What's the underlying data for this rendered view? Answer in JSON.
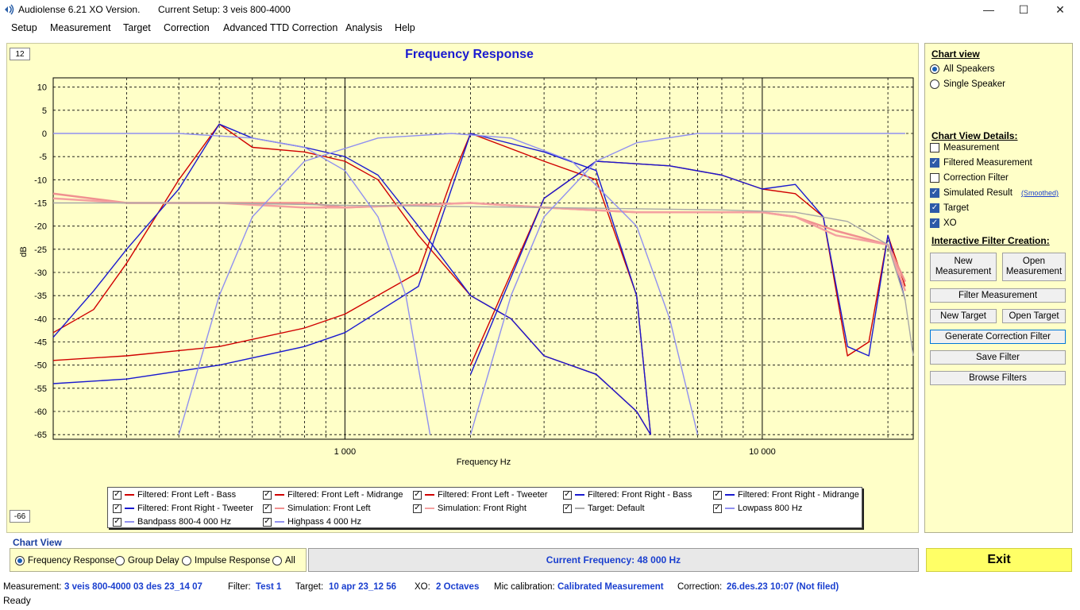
{
  "window": {
    "app_title": "Audiolense 6.21 XO Version.",
    "setup": "Current Setup: 3 veis 800-4000",
    "minimize": "—",
    "maximize": "☐",
    "close": "✕"
  },
  "menu": [
    "Setup",
    "Measurement",
    "Target",
    "Correction",
    "Advanced TTD Correction",
    "Analysis",
    "Help"
  ],
  "chart": {
    "top_box": "12",
    "bottom_box": "-66",
    "y_ticks": [
      "10",
      "5",
      "0",
      "-5",
      "-10",
      "-15",
      "-20",
      "-25",
      "-30",
      "-35",
      "-40",
      "-45",
      "-50",
      "-55",
      "-60",
      "-65"
    ],
    "x_ticks": [
      "1 000",
      "10 000"
    ]
  },
  "chart_data": {
    "type": "line",
    "title": "Frequency Response",
    "xlabel": "Frequency Hz",
    "ylabel": "dB",
    "x_scale": "log",
    "xlim": [
      200,
      23000
    ],
    "ylim": [
      -66,
      12
    ],
    "grid": true,
    "legend_placement": "bottom",
    "series": [
      {
        "name": "Filtered: Front Left - Bass",
        "color": "#d00000",
        "x": [
          200,
          250,
          300,
          400,
          500,
          600,
          800,
          1000,
          1200,
          1500,
          2000,
          2500,
          3000,
          4000,
          5000,
          5400
        ],
        "y": [
          -43,
          -38,
          -28,
          -10,
          2,
          -3,
          -4,
          -6,
          -10,
          -22,
          -35,
          -40,
          -48,
          -52,
          -60,
          -65
        ]
      },
      {
        "name": "Filtered: Front Left - Midrange",
        "color": "#d00000",
        "x": [
          200,
          300,
          500,
          800,
          1000,
          1500,
          1800,
          2000,
          3000,
          4000,
          5000,
          5400
        ],
        "y": [
          -49,
          -48,
          -46,
          -42,
          -39,
          -30,
          -10,
          0,
          -6,
          -10,
          -35,
          -65
        ]
      },
      {
        "name": "Filtered: Front Left - Tweeter",
        "color": "#d00000",
        "x": [
          2000,
          3000,
          4000,
          6000,
          8000,
          10000,
          12000,
          14000,
          16000,
          18000,
          20000,
          22000
        ],
        "y": [
          -50,
          -14,
          -6,
          -7,
          -9,
          -12,
          -13,
          -18,
          -48,
          -45,
          -22,
          -33
        ]
      },
      {
        "name": "Filtered: Front Right - Bass",
        "color": "#1a1ad0",
        "x": [
          200,
          250,
          300,
          400,
          500,
          600,
          800,
          1000,
          1200,
          1500,
          2000,
          2500,
          3000,
          4000,
          5000,
          5400
        ],
        "y": [
          -44,
          -34,
          -25,
          -12,
          2,
          -1,
          -3,
          -5,
          -9,
          -20,
          -35,
          -40,
          -48,
          -52,
          -60,
          -65
        ]
      },
      {
        "name": "Filtered: Front Right - Midrange",
        "color": "#1a1ad0",
        "x": [
          200,
          300,
          500,
          800,
          1000,
          1500,
          1800,
          2000,
          3000,
          4000,
          5000,
          5400
        ],
        "y": [
          -54,
          -53,
          -50,
          -46,
          -43,
          -33,
          -12,
          0,
          -4,
          -8,
          -35,
          -65
        ]
      },
      {
        "name": "Filtered: Front Right - Tweeter",
        "color": "#1a1ad0",
        "x": [
          2000,
          3000,
          4000,
          6000,
          8000,
          10000,
          12000,
          14000,
          16000,
          18000,
          20000,
          22000
        ],
        "y": [
          -52,
          -14,
          -6,
          -7,
          -9,
          -12,
          -11,
          -18,
          -46,
          -48,
          -22,
          -36
        ]
      },
      {
        "name": "Simulation: Front Left",
        "color": "#f09090",
        "x": [
          200,
          300,
          500,
          800,
          1000,
          2000,
          3000,
          5000,
          8000,
          10000,
          12000,
          15000,
          20000,
          22000
        ],
        "y": [
          -13,
          -15,
          -15,
          -15,
          -16,
          -15,
          -16,
          -17,
          -17,
          -17,
          -18,
          -21,
          -24,
          -32
        ]
      },
      {
        "name": "Simulation: Front Right",
        "color": "#f4a0a0",
        "x": [
          200,
          300,
          500,
          800,
          1000,
          2000,
          3000,
          5000,
          8000,
          10000,
          12000,
          15000,
          20000,
          22000
        ],
        "y": [
          -14,
          -15,
          -15,
          -16,
          -16,
          -15,
          -16,
          -17,
          -17,
          -17,
          -18,
          -22,
          -24,
          -34
        ]
      },
      {
        "name": "Target: Default",
        "color": "#a8a8a8",
        "x": [
          200,
          500,
          1000,
          3000,
          8000,
          12000,
          16000,
          20000,
          22000,
          23000
        ],
        "y": [
          -15,
          -15,
          -15.5,
          -16,
          -16.5,
          -17,
          -19,
          -24,
          -36,
          -48
        ]
      },
      {
        "name": "Lowpass 800 Hz",
        "color": "#9090f0",
        "x": [
          200,
          400,
          600,
          800,
          1000,
          1200,
          1400,
          1600
        ],
        "y": [
          0,
          0,
          -1,
          -3,
          -8,
          -18,
          -35,
          -65
        ]
      },
      {
        "name": "Bandpass 800-4 000 Hz",
        "color": "#9090f0",
        "x": [
          400,
          500,
          600,
          800,
          1200,
          1800,
          2500,
          3500,
          5000,
          6000,
          7000
        ],
        "y": [
          -65,
          -35,
          -18,
          -6,
          -1,
          0,
          -1,
          -6,
          -20,
          -40,
          -65
        ]
      },
      {
        "name": "Highpass 4 000 Hz",
        "color": "#9090f0",
        "x": [
          2000,
          2500,
          3000,
          4000,
          5000,
          7000,
          10000,
          22000
        ],
        "y": [
          -65,
          -35,
          -18,
          -6,
          -2,
          0,
          0,
          0
        ]
      }
    ]
  },
  "legend": [
    {
      "label": "Filtered: Front Left - Bass",
      "color": "#d00000"
    },
    {
      "label": "Filtered: Front Left - Midrange",
      "color": "#d00000"
    },
    {
      "label": "Filtered: Front Left - Tweeter",
      "color": "#d00000"
    },
    {
      "label": "Filtered: Front Right - Bass",
      "color": "#1a1ad0"
    },
    {
      "label": "Filtered: Front Right - Midrange",
      "color": "#1a1ad0"
    },
    {
      "label": "Filtered: Front Right - Tweeter",
      "color": "#1a1ad0"
    },
    {
      "label": "Simulation: Front Left",
      "color": "#f09090"
    },
    {
      "label": "Simulation: Front Right",
      "color": "#f4a0a0"
    },
    {
      "label": "Target: Default",
      "color": "#a8a8a8"
    },
    {
      "label": "Lowpass  800 Hz",
      "color": "#9090f0"
    },
    {
      "label": "Bandpass  800-4 000 Hz",
      "color": "#9090f0"
    },
    {
      "label": "Highpass  4 000 Hz",
      "color": "#9090f0"
    }
  ],
  "side": {
    "chart_view_heading": "Chart view",
    "all_speakers": "All Speakers",
    "single_speaker": "Single Speaker",
    "details_heading": "Chart View Details:",
    "measurement": "Measurement",
    "filtered_measurement": "Filtered Measurement",
    "correction_filter": "Correction Filter",
    "simulated_result": "Simulated Result",
    "smoothed": "(Smoothed)",
    "target": "Target",
    "xo": "XO",
    "interactive_heading": "Interactive Filter Creation:",
    "new_measurement": "New Measurement",
    "open_measurement": "Open Measurement",
    "filter_measurement": "Filter Measurement",
    "new_target": "New Target",
    "open_target": "Open Target",
    "generate_correction_filter": "Generate Correction Filter",
    "save_filter": "Save Filter",
    "browse_filters": "Browse Filters"
  },
  "bottom": {
    "chart_view_label": "Chart View",
    "frequency_response": "Frequency Response",
    "group_delay": "Group Delay",
    "impulse_response": "Impulse Response",
    "all": "All",
    "current_frequency": "Current Frequency: 48 000 Hz",
    "exit": "Exit"
  },
  "status": {
    "measurement_label": "Measurement:",
    "measurement_value": "3 veis 800-4000 03 des 23_14 07",
    "filter_label": "Filter:",
    "filter_value": "Test 1",
    "target_label": "Target:",
    "target_value": "10 apr 23_12 56",
    "xo_label": "XO:",
    "xo_value": "2 Octaves",
    "mic_label": "Mic calibration:",
    "mic_value": "Calibrated Measurement",
    "correction_label": "Correction:",
    "correction_value": "26.des.23 10:07 (Not filed)",
    "ready": "Ready"
  }
}
